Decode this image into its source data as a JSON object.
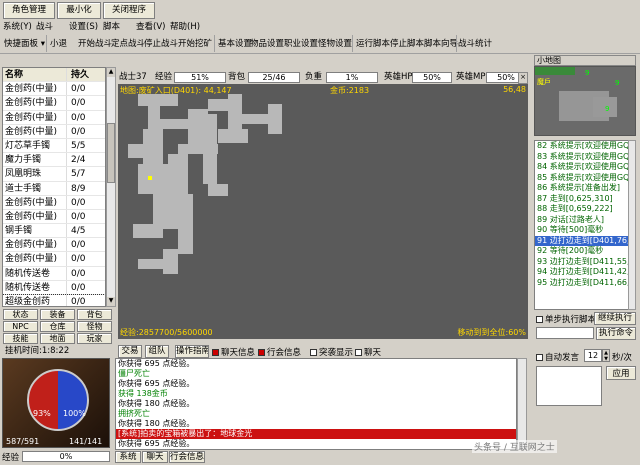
{
  "topbar": {
    "role_mgmt": "角色管理",
    "minimize": "最小化",
    "close": "关闭程序"
  },
  "menu": [
    "系统(Y)",
    "战斗",
    "设置(S)",
    "脚本",
    "查看(V)",
    "帮助(H)"
  ],
  "toolbar": {
    "panel": "快捷面板",
    "items": [
      "小退",
      "开始战斗",
      "定点战斗",
      "停止战斗",
      "开始挖矿",
      "基本设置",
      "物品设置",
      "职业设置",
      "怪物设置",
      "运行脚本",
      "停止脚本",
      "脚本向导",
      "战斗统计"
    ]
  },
  "items_table": {
    "headers": [
      "名称",
      "持久"
    ],
    "rows": [
      [
        "金创药(中量)",
        "0/0"
      ],
      [
        "金创药(中量)",
        "0/0"
      ],
      [
        "金创药(中量)",
        "0/0"
      ],
      [
        "金创药(中量)",
        "0/0"
      ],
      [
        "灯芯草手镯",
        "5/5"
      ],
      [
        "魔力手镯",
        "2/4"
      ],
      [
        "凤凰明珠",
        "5/7"
      ],
      [
        "道士手镯",
        "8/9"
      ],
      [
        "金创药(中量)",
        "0/0"
      ],
      [
        "金创药(中量)",
        "0/0"
      ],
      [
        "钢手镯",
        "4/5"
      ],
      [
        "金创药(中量)",
        "0/0"
      ],
      [
        "金创药(中量)",
        "0/0"
      ],
      [
        "随机传送卷",
        "0/0"
      ],
      [
        "随机传送卷",
        "0/0"
      ],
      [
        "超级金创药",
        "0/0"
      ]
    ]
  },
  "tabs_grid": [
    "状态",
    "装备",
    "背包",
    "NPC",
    "仓库",
    "怪物",
    "技能",
    "地面",
    "玩家"
  ],
  "stats": {
    "class_level": "战士37",
    "exp_label": "经验",
    "exp_value": "51%",
    "bag_label": "背包",
    "bag_value": "25/46",
    "weight_label": "负重",
    "weight_value": "1%",
    "hero_hp_label": "英雄HP",
    "hero_hp_value": "50%",
    "hero_mp_label": "英雄MP",
    "hero_mp_value": "50%"
  },
  "map": {
    "location": "地图:废矿入口(D401): 44,147",
    "gold": "金币:2183",
    "coord": "56,48",
    "bottom_left": "经验:2857700/5600000",
    "bottom_right": "移动到到全位:60%"
  },
  "minimap": {
    "title": "小地图",
    "marks": [
      "9",
      "9",
      "魔戶",
      "9"
    ]
  },
  "script_log": [
    "82 系统提示[欢迎使用GQ:9",
    "83 系统提示[欢迎使用GQ:9",
    "84 系统提示[欢迎使用GQ:9",
    "85 系统提示[欢迎使用GQ:9",
    "86 系统提示[准备出发]",
    "87 走到[0,625,310]",
    "88 走到[0,659,222]",
    "89 对话[过路老人]",
    "90 等待[500]毫秒",
    "91 边打边走到[D401,76,",
    "92 等待[200]毫秒",
    "93 边打边走到[D411,55,34]",
    "94 边打边走到[D411,42,68]",
    "95 边打边走到[D411,66,68]"
  ],
  "script_controls": {
    "single_step": "单步执行脚本",
    "continue": "继续执行",
    "exec_cmd": "执行命令"
  },
  "char": {
    "name_time": "挂机时间:1:8:22",
    "hp_pct": "93%",
    "mp_pct": "100%",
    "hp_numbers": "587/591",
    "mp_numbers": "141/141",
    "exp_label": "经验",
    "exp_pct": "0%"
  },
  "chat_tabs": [
    "交易",
    "组队",
    "操作指南",
    "聊天信息",
    "行会信息",
    "突袭显示",
    "聊天"
  ],
  "chat_lines": [
    {
      "t": "你获得 695 点经验。",
      "c": ""
    },
    {
      "t": "僵尸死亡",
      "c": "green"
    },
    {
      "t": "你获得 695 点经验。",
      "c": ""
    },
    {
      "t": "获得 138金币",
      "c": "green"
    },
    {
      "t": "你获得 180 点经验。",
      "c": ""
    },
    {
      "t": "拥挤死亡",
      "c": "green"
    },
    {
      "t": "你获得 180 点经验。",
      "c": ""
    },
    {
      "t": "[系统]拍卖的宝箱被暴出了：地球金光",
      "c": "redrow"
    },
    {
      "t": "你获得 695 点经验。",
      "c": ""
    },
    {
      "t": "僵尸死亡",
      "c": "green"
    }
  ],
  "bottom_tabs": [
    "系统",
    "聊天",
    "行会信息"
  ],
  "auto_speak": {
    "label": "自动发言",
    "value": "12",
    "unit": "秒/次",
    "apply": "应用"
  },
  "watermark": "头条号 / 互联网之士"
}
